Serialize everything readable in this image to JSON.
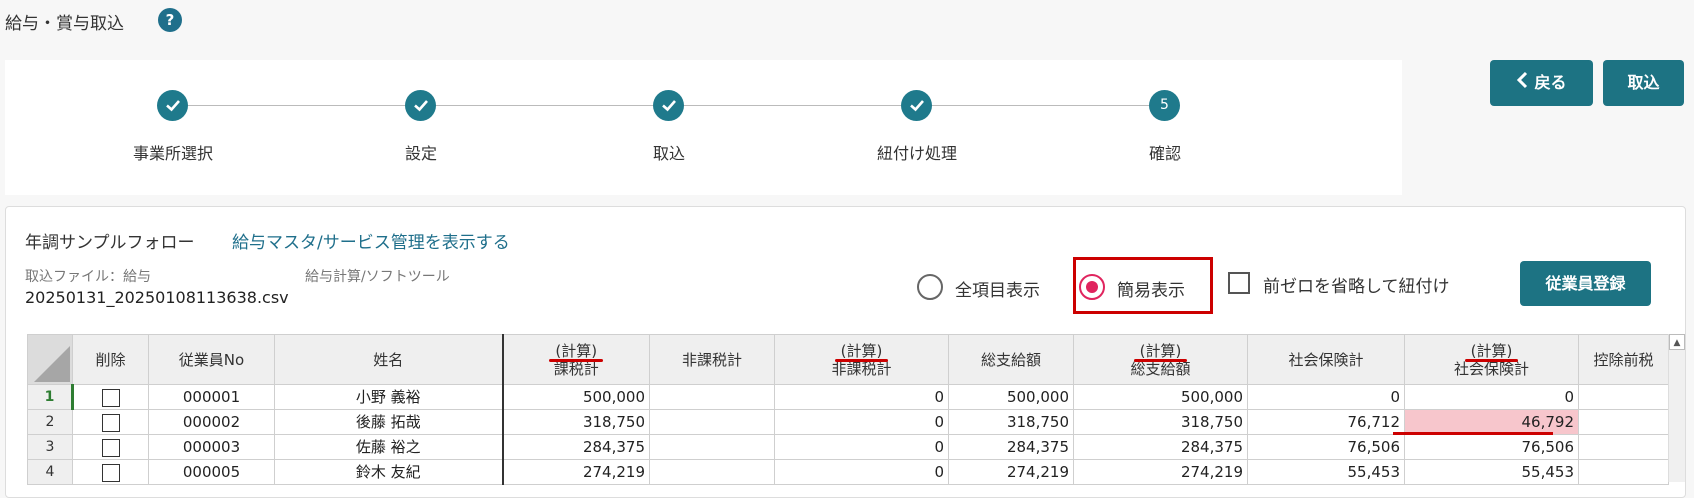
{
  "header": {
    "title": "給与・賞与取込",
    "help_icon": "?"
  },
  "steps": [
    {
      "label": "事業所選択",
      "state": "done"
    },
    {
      "label": "設定",
      "state": "done"
    },
    {
      "label": "取込",
      "state": "done"
    },
    {
      "label": "紐付け処理",
      "state": "done"
    },
    {
      "label": "確認",
      "state": "current",
      "number": "5"
    }
  ],
  "actions": {
    "back_label": "戻る",
    "back_icon": "chevron-left-icon",
    "import_label": "取込"
  },
  "panel": {
    "company": "年調サンプルフォロー",
    "master_link": "給与マスタ/サービス管理を表示する",
    "file_label": "取込ファイル：給与",
    "software_label": "給与計算/ソフトツール",
    "file_name": "20250131_20250108113638.csv",
    "view_all_label": "全項目表示",
    "view_simple_label": "簡易表示",
    "view_selected": "simple",
    "zero_omit_label": "前ゼロを省略して紐付け",
    "zero_omit_checked": false,
    "register_label": "従業員登録"
  },
  "table": {
    "calc_tag": "(計算)",
    "headers": {
      "delete": "削除",
      "emp_no": "従業員No",
      "name": "姓名",
      "taxable": "課税計",
      "nontaxable": "非課税計",
      "calc_nontaxable": "非課税計",
      "gross": "総支給額",
      "calc_gross": "総支給額",
      "social": "社会保険計",
      "calc_social": "社会保険計",
      "pre_deduction": "控除前税"
    },
    "rows": [
      {
        "num": "1",
        "emp_no": "000001",
        "name": "小野 義裕",
        "taxable": "500,000",
        "nontaxable": "",
        "calc_nontaxable": "0",
        "gross": "500,000",
        "calc_gross": "500,000",
        "social": "0",
        "calc_social": "0",
        "pre_deduction": ""
      },
      {
        "num": "2",
        "emp_no": "000002",
        "name": "後藤 拓哉",
        "taxable": "318,750",
        "nontaxable": "",
        "calc_nontaxable": "0",
        "gross": "318,750",
        "calc_gross": "318,750",
        "social": "76,712",
        "calc_social": "46,792",
        "pre_deduction": ""
      },
      {
        "num": "3",
        "emp_no": "000003",
        "name": "佐藤 裕之",
        "taxable": "284,375",
        "nontaxable": "",
        "calc_nontaxable": "0",
        "gross": "284,375",
        "calc_gross": "284,375",
        "social": "76,506",
        "calc_social": "76,506",
        "pre_deduction": ""
      },
      {
        "num": "4",
        "emp_no": "000005",
        "name": "鈴木 友紀",
        "taxable": "274,219",
        "nontaxable": "",
        "calc_nontaxable": "0",
        "gross": "274,219",
        "calc_gross": "274,219",
        "social": "55,453",
        "calc_social": "55,453",
        "pre_deduction": ""
      }
    ]
  },
  "colors": {
    "accent": "#1d7383",
    "highlight": "#c00000",
    "mismatch": "#f7c6cc",
    "radio": "#e0245e"
  }
}
